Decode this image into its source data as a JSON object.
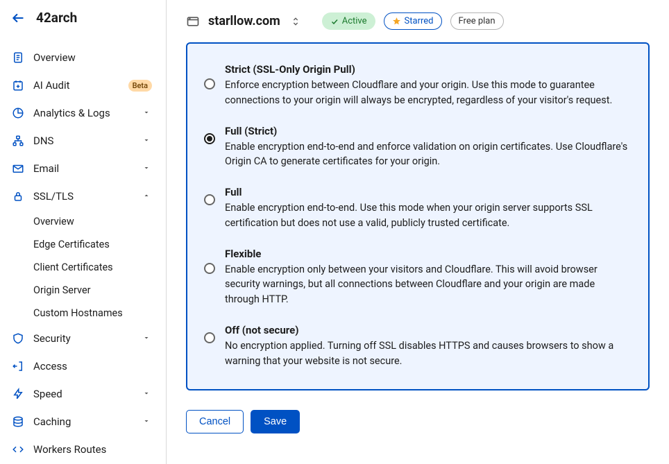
{
  "header": {
    "org_name": "42arch"
  },
  "sidebar": {
    "items": [
      {
        "label": "Overview"
      },
      {
        "label": "AI Audit",
        "badge": "Beta"
      },
      {
        "label": "Analytics & Logs"
      },
      {
        "label": "DNS"
      },
      {
        "label": "Email"
      },
      {
        "label": "SSL/TLS"
      },
      {
        "label": "Security"
      },
      {
        "label": "Access"
      },
      {
        "label": "Speed"
      },
      {
        "label": "Caching"
      },
      {
        "label": "Workers Routes"
      }
    ],
    "ssl_sub": [
      {
        "label": "Overview"
      },
      {
        "label": "Edge Certificates"
      },
      {
        "label": "Client Certificates"
      },
      {
        "label": "Origin Server"
      },
      {
        "label": "Custom Hostnames"
      }
    ]
  },
  "topbar": {
    "site_name": "starllow.com",
    "active_label": "Active",
    "starred_label": "Starred",
    "plan_label": "Free plan"
  },
  "ssl_options": [
    {
      "title": "Strict (SSL-Only Origin Pull)",
      "desc": "Enforce encryption between Cloudflare and your origin. Use this mode to guarantee connections to your origin will always be encrypted, regardless of your visitor's request.",
      "selected": false
    },
    {
      "title": "Full (Strict)",
      "desc": "Enable encryption end-to-end and enforce validation on origin certificates. Use Cloudflare's Origin CA to generate certificates for your origin.",
      "selected": true
    },
    {
      "title": "Full",
      "desc": "Enable encryption end-to-end. Use this mode when your origin server supports SSL certification but does not use a valid, publicly trusted certificate.",
      "selected": false
    },
    {
      "title": "Flexible",
      "desc": "Enable encryption only between your visitors and Cloudflare. This will avoid browser security warnings, but all connections between Cloudflare and your origin are made through HTTP.",
      "selected": false
    },
    {
      "title": "Off (not secure)",
      "desc": "No encryption applied. Turning off SSL disables HTTPS and causes browsers to show a warning that your website is not secure.",
      "selected": false
    }
  ],
  "buttons": {
    "cancel": "Cancel",
    "save": "Save"
  }
}
